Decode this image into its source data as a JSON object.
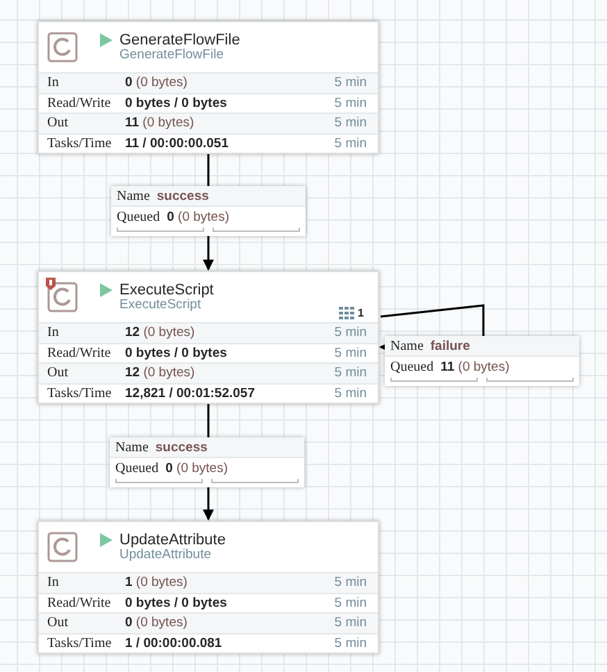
{
  "processors": [
    {
      "name": "GenerateFlowFile",
      "type": "GenerateFlowFile",
      "running": true,
      "invalid": false,
      "stats": [
        {
          "label": "In",
          "value": "**0** (0 bytes)",
          "time": "5 min"
        },
        {
          "label": "Read/Write",
          "value": "**0 bytes / 0 bytes**",
          "time": "5 min"
        },
        {
          "label": "Out",
          "value": "**11** (0 bytes)",
          "time": "5 min"
        },
        {
          "label": "Tasks/Time",
          "value": "**11 / 00:00:00.051**",
          "time": "5 min"
        }
      ]
    },
    {
      "name": "ExecuteScript",
      "type": "ExecuteScript",
      "running": true,
      "invalid": true,
      "threads": "1",
      "stats": [
        {
          "label": "In",
          "value": "**12** (0 bytes)",
          "time": "5 min"
        },
        {
          "label": "Read/Write",
          "value": "**0 bytes / 0 bytes**",
          "time": "5 min"
        },
        {
          "label": "Out",
          "value": "**12** (0 bytes)",
          "time": "5 min"
        },
        {
          "label": "Tasks/Time",
          "value": "**12,821 / 00:01:52.057**",
          "time": "5 min"
        }
      ]
    },
    {
      "name": "UpdateAttribute",
      "type": "UpdateAttribute",
      "running": true,
      "invalid": false,
      "stats": [
        {
          "label": "In",
          "value": "**1** (0 bytes)",
          "time": "5 min"
        },
        {
          "label": "Read/Write",
          "value": "**0 bytes / 0 bytes**",
          "time": "5 min"
        },
        {
          "label": "Out",
          "value": "**0** (0 bytes)",
          "time": "5 min"
        },
        {
          "label": "Tasks/Time",
          "value": "**1 / 00:00:00.081**",
          "time": "5 min"
        }
      ]
    }
  ],
  "connections": [
    {
      "name_label": "Name",
      "name": "success",
      "queued_label": "Queued",
      "queued": "**0** (0 bytes)"
    },
    {
      "name_label": "Name",
      "name": "failure",
      "queued_label": "Queued",
      "queued": "**11** (0 bytes)"
    },
    {
      "name_label": "Name",
      "name": "success",
      "queued_label": "Queued",
      "queued": "**0** (0 bytes)"
    }
  ]
}
